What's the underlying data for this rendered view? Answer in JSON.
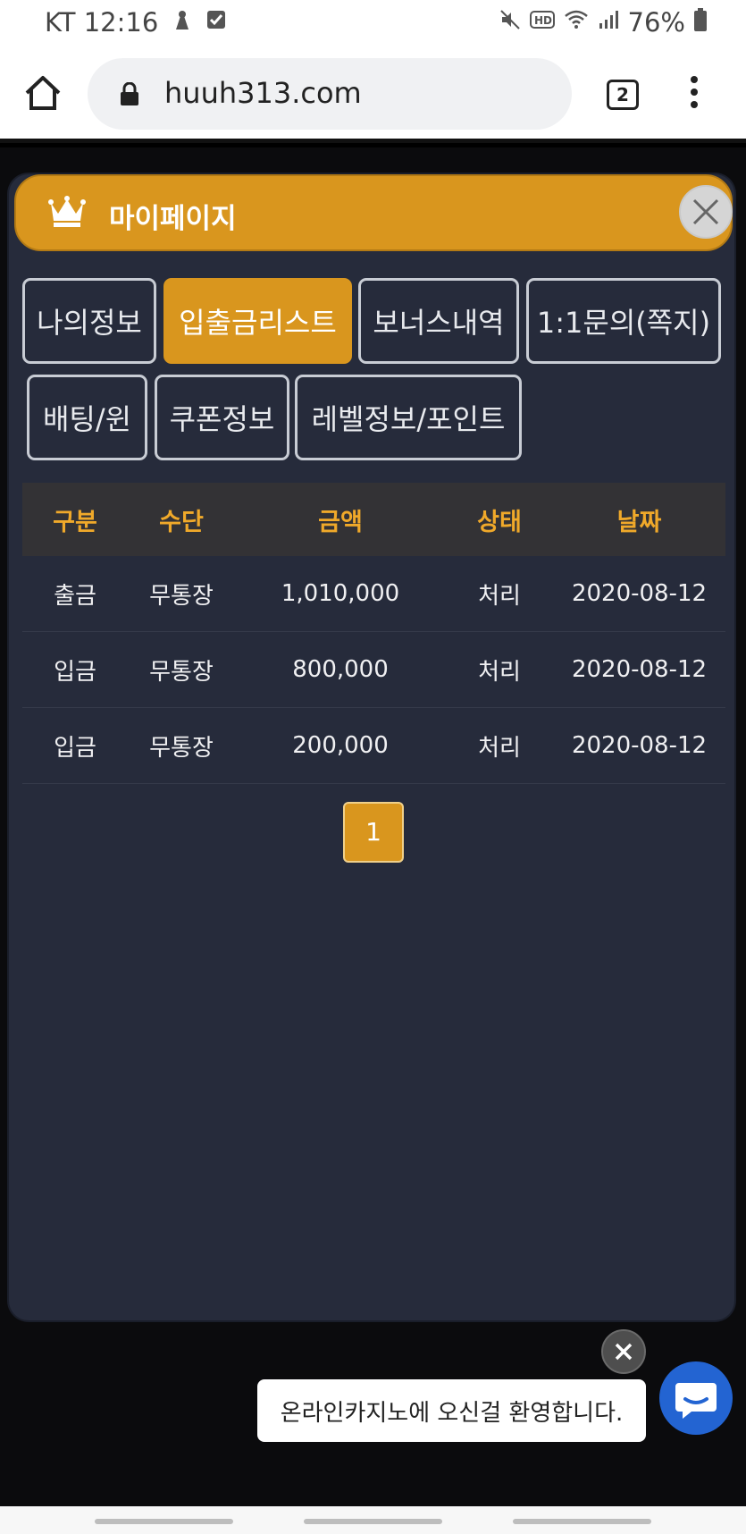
{
  "status_bar": {
    "carrier_time": "KT 12:16",
    "battery": "76%",
    "icons": [
      "ninja-icon",
      "check-icon",
      "mute-icon",
      "hd-icon",
      "wifi-icon",
      "signal-icon",
      "battery-icon"
    ]
  },
  "browser": {
    "url": "huuh313.com",
    "tab_count": "2"
  },
  "modal": {
    "title": "마이페이지",
    "tabs": [
      {
        "label": "나의정보",
        "active": false
      },
      {
        "label": "입출금리스트",
        "active": true
      },
      {
        "label": "보너스내역",
        "active": false
      },
      {
        "label": "1:1문의(쪽지)",
        "active": false
      },
      {
        "label": "배팅/윈",
        "active": false
      },
      {
        "label": "쿠폰정보",
        "active": false
      },
      {
        "label": "레벨정보/포인트",
        "active": false
      }
    ],
    "table": {
      "headers": [
        "구분",
        "수단",
        "금액",
        "상태",
        "날짜"
      ],
      "rows": [
        [
          "출금",
          "무통장",
          "1,010,000",
          "처리",
          "2020-08-12"
        ],
        [
          "입금",
          "무통장",
          "800,000",
          "처리",
          "2020-08-12"
        ],
        [
          "입금",
          "무통장",
          "200,000",
          "처리",
          "2020-08-12"
        ]
      ]
    },
    "pagination": {
      "current_page": "1"
    }
  },
  "chat": {
    "message": "온라인카지노에 오신걸 환영합니다."
  },
  "colors": {
    "accent": "#d9961e",
    "panel": "#262b3b",
    "header_text": "#f0a92a",
    "chat_blue": "#2364d2"
  }
}
